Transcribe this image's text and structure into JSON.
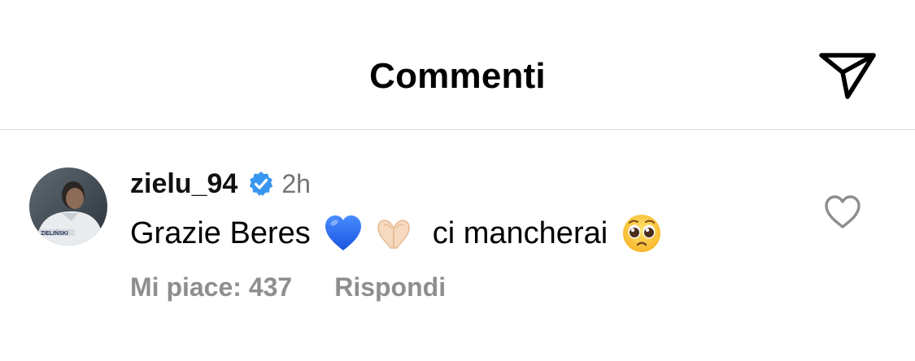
{
  "header": {
    "title": "Commenti",
    "share_icon": "paper-plane-icon"
  },
  "comment": {
    "username": "zielu_94",
    "verified": true,
    "time": "2h",
    "text_part1": "Grazie Beres",
    "text_part2": "ci mancherai",
    "emojis": [
      "blue-heart",
      "heart-hands",
      "pleading-face"
    ],
    "jersey_text": "ZIELIŃSKI",
    "likes_label": "Mi piace: 437",
    "reply_label": "Rispondi",
    "like_icon": "heart-outline-icon"
  },
  "colors": {
    "text": "#000000",
    "secondary": "#8e8e8e",
    "timestamp": "#737373",
    "verified": "#3897f0",
    "divider": "#dbdbdb"
  }
}
